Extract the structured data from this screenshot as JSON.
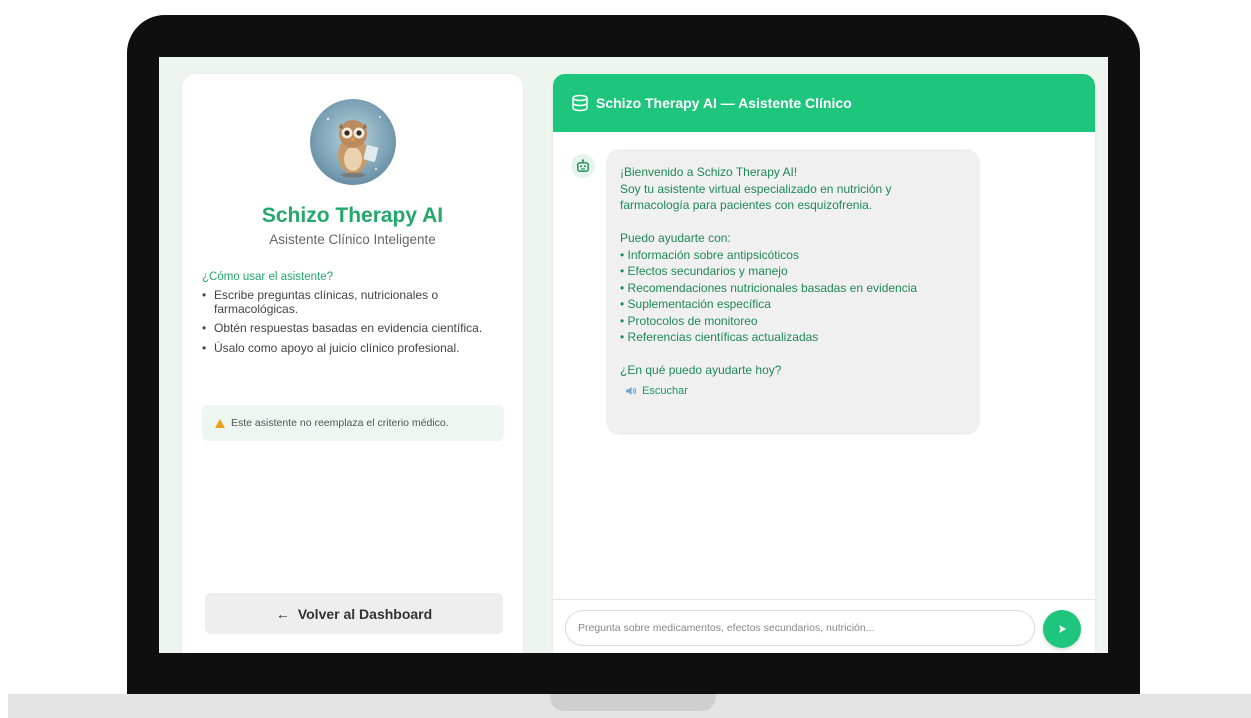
{
  "sidebar": {
    "title": "Schizo Therapy AI",
    "subtitle": "Asistente Clínico Inteligente",
    "howto_title": "¿Cómo usar el asistente?",
    "howto_items": [
      "Escribe preguntas clínicas, nutricionales o farmacológicas.",
      "Obtén respuestas basadas en evidencia científica.",
      "Úsalo como apoyo al juicio clínico profesional."
    ],
    "warning": "Este asistente no reemplaza el criterio médico.",
    "back_button": "Volver al Dashboard",
    "back_arrow": "←"
  },
  "chat": {
    "header_title": "Schizo Therapy AI — Asistente Clínico",
    "welcome": {
      "line1": "¡Bienvenido a Schizo Therapy AI!",
      "line2": "Soy tu asistente virtual especializado en nutrición y",
      "line3": "farmacología para pacientes con esquizofrenia.",
      "intro": "Puedo ayudarte con:",
      "items": [
        "• Información sobre antipsicóticos",
        "• Efectos secundarios y manejo",
        "• Recomendaciones nutricionales basadas en evidencia",
        "• Suplementación específica",
        "• Protocolos de monitoreo",
        "• Referencias científicas actualizadas"
      ],
      "question": "¿En qué puedo ayudarte hoy?"
    },
    "listen_label": "Escuchar",
    "input_placeholder": "Pregunta sobre medicamentos, efectos secundarios, nutrición..."
  },
  "colors": {
    "accent": "#1ec67d",
    "accent_text": "#23a86a",
    "warning": "#f0a020",
    "bezel": "#0f0f0f"
  },
  "icons": {
    "header": "database-icon",
    "bot": "robot-icon",
    "listen": "speaker-icon",
    "send": "send-icon",
    "warning": "warning-icon",
    "avatar": "owl-avatar"
  }
}
